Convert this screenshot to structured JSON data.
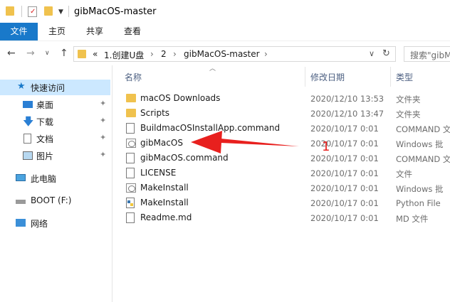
{
  "window": {
    "title": "gibMacOS-master"
  },
  "ribbon": {
    "tabs": [
      "文件",
      "主页",
      "共享",
      "查看"
    ]
  },
  "address": {
    "crumbs": [
      "«",
      "1.创建U盘",
      "›",
      "2",
      "›",
      "gibMacOS-master",
      "›"
    ],
    "search_placeholder": "搜索\"gibM"
  },
  "sidebar": {
    "items": [
      {
        "label": "快速访问",
        "icon": "star-icon",
        "pinned": false
      },
      {
        "label": "桌面",
        "icon": "desktop-icon",
        "pinned": true
      },
      {
        "label": "下载",
        "icon": "download-arrow-icon",
        "pinned": true
      },
      {
        "label": "文档",
        "icon": "documents-icon",
        "pinned": true
      },
      {
        "label": "图片",
        "icon": "pictures-icon",
        "pinned": true
      },
      {
        "label": "此电脑",
        "icon": "computer-icon",
        "pinned": false
      },
      {
        "label": "BOOT (F:)",
        "icon": "drive-icon",
        "pinned": false
      },
      {
        "label": "网络",
        "icon": "network-icon",
        "pinned": false
      }
    ],
    "pin_glyph": "📌"
  },
  "columns": {
    "name": "名称",
    "date": "修改日期",
    "type": "类型"
  },
  "files": [
    {
      "name": "macOS Downloads",
      "date": "2020/12/10 13:53",
      "type": "文件夹",
      "icon": "folder-icon"
    },
    {
      "name": "Scripts",
      "date": "2020/12/10 13:47",
      "type": "文件夹",
      "icon": "folder-icon"
    },
    {
      "name": "BuildmacOSInstallApp.command",
      "date": "2020/10/17 0:01",
      "type": "COMMAND 文",
      "icon": "file-icon"
    },
    {
      "name": "gibMacOS",
      "date": "2020/10/17 0:01",
      "type": "Windows 批",
      "icon": "batch-file-icon"
    },
    {
      "name": "gibMacOS.command",
      "date": "2020/10/17 0:01",
      "type": "COMMAND 文",
      "icon": "file-icon"
    },
    {
      "name": "LICENSE",
      "date": "2020/10/17 0:01",
      "type": "文件",
      "icon": "file-icon"
    },
    {
      "name": "MakeInstall",
      "date": "2020/10/17 0:01",
      "type": "Windows 批",
      "icon": "batch-file-icon"
    },
    {
      "name": "MakeInstall",
      "date": "2020/10/17 0:01",
      "type": "Python File",
      "icon": "python-file-icon"
    },
    {
      "name": "Readme.md",
      "date": "2020/10/17 0:01",
      "type": "MD 文件",
      "icon": "file-icon"
    }
  ],
  "annotation": {
    "number": "1",
    "color": "#e8201e"
  },
  "colors": {
    "accent": "#1979ca",
    "selected": "#cce8ff",
    "folder": "#f0c24e"
  }
}
